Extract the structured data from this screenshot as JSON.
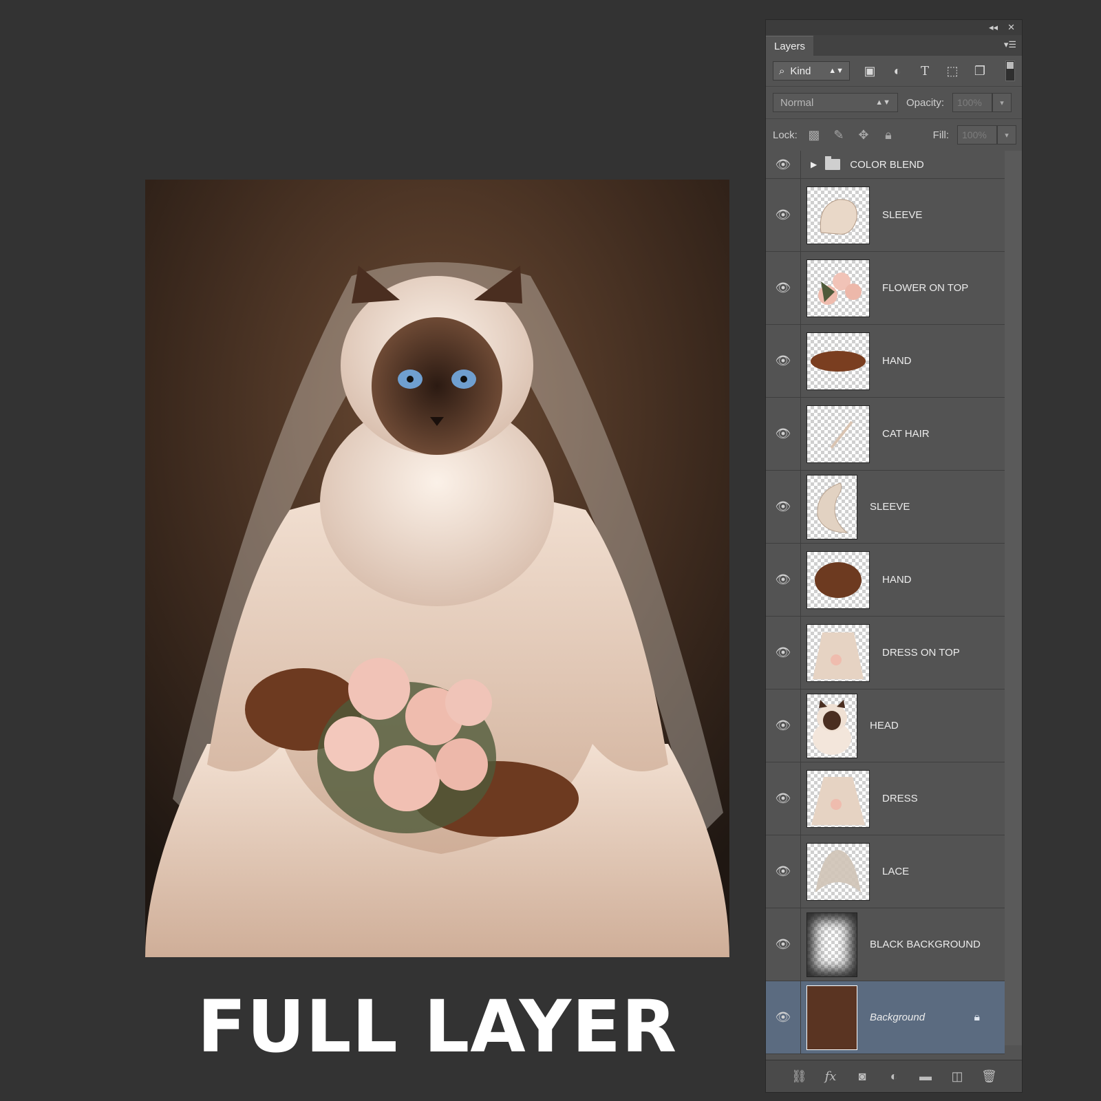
{
  "caption": "FULL LAYER",
  "panel": {
    "tab_label": "Layers",
    "filter": {
      "kind_label": "Kind"
    },
    "blend": {
      "mode": "Normal",
      "opacity_label": "Opacity:",
      "opacity_value": "100%"
    },
    "lock": {
      "lock_label": "Lock:",
      "fill_label": "Fill:",
      "fill_value": "100%"
    },
    "group": {
      "name": "COLOR BLEND"
    },
    "layers": [
      {
        "name": "SLEEVE"
      },
      {
        "name": "FLOWER ON TOP"
      },
      {
        "name": "HAND"
      },
      {
        "name": "CAT HAIR"
      },
      {
        "name": "SLEEVE"
      },
      {
        "name": "HAND"
      },
      {
        "name": "DRESS ON TOP"
      },
      {
        "name": "HEAD"
      },
      {
        "name": "DRESS"
      },
      {
        "name": "LACE"
      },
      {
        "name": "BLACK BACKGROUND"
      },
      {
        "name": "Background"
      }
    ]
  },
  "colors": {
    "ui_background": "#333333",
    "panel_background": "#535353",
    "selected_layer": "#5b6b80",
    "artwork_background": "#3a2a20"
  },
  "icons": {
    "collapse": "double-chevron-left-icon",
    "close": "close-icon",
    "panel_menu": "panel-menu-icon",
    "visibility": "eye-icon"
  }
}
